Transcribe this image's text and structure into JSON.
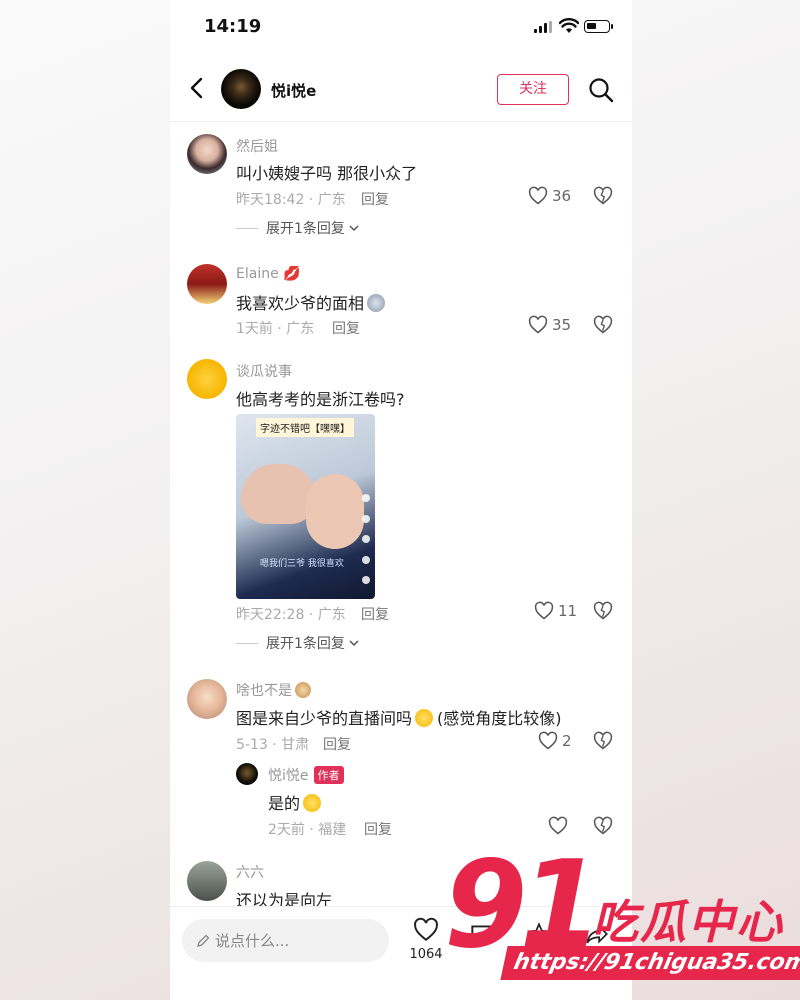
{
  "status": {
    "time": "14:19"
  },
  "header": {
    "name": "悦i悦e",
    "follow_label": "关注"
  },
  "comments": [
    {
      "user": "然后姐",
      "text": "叫小姨嫂子吗 那很小众了",
      "meta": "昨天18:42 · 广东",
      "reply": "回复",
      "likes": "36",
      "expand": "展开1条回复"
    },
    {
      "user": "Elaine",
      "text": "我喜欢少爷的面相",
      "meta": "1天前 · 广东",
      "reply": "回复",
      "likes": "35"
    },
    {
      "user": "谈瓜说事",
      "text": "他高考考的是浙江卷吗?",
      "meta": "昨天22:28 · 广东",
      "reply": "回复",
      "likes": "11",
      "expand": "展开1条回复",
      "image": {
        "caption": "字迹不错吧【嘿嘿】",
        "subtitle": "嗯我们三爷 我很喜欢"
      }
    },
    {
      "user": "啥也不是",
      "text": "图是来自少爷的直播间吗",
      "text_suffix": "(感觉角度比较像)",
      "meta": "5-13 · 甘肃",
      "reply": "回复",
      "likes": "2"
    },
    {
      "user": "六六",
      "text": "还以为是向左"
    }
  ],
  "author_reply": {
    "user": "悦i悦e",
    "tag": "作者",
    "text": "是的",
    "meta": "2天前 · 福建",
    "reply": "回复"
  },
  "bottom": {
    "placeholder": "说点什么...",
    "likes": "1064"
  },
  "watermark": {
    "number": "91",
    "brand": "吃瓜中心",
    "url": "https://91chigua35.com"
  },
  "colors": {
    "accent": "#e0315a",
    "watermark": "#e6264a"
  }
}
